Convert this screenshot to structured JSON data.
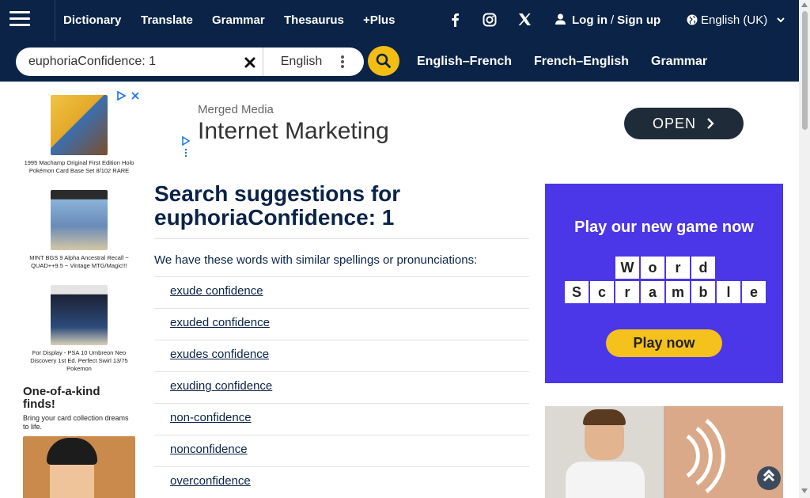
{
  "header": {
    "nav": [
      "Dictionary",
      "Translate",
      "Grammar",
      "Thesaurus",
      "+Plus"
    ],
    "social": [
      "facebook-icon",
      "instagram-icon",
      "x-icon"
    ],
    "login_label": "Log in",
    "signup_label": "Sign up",
    "language": "English (UK)"
  },
  "search": {
    "value": "euphoriaConfidence: 1",
    "language": "English"
  },
  "subnav": [
    "English–French",
    "French–English",
    "Grammar"
  ],
  "left_ad": {
    "cards": [
      "1995 Machamp Original First Edition Holo Pokémon Card Base Set 8/102 RARE",
      "MINT BGS 9 Alpha Ancestral Recall ~ QUAD++9.5 ~ Vintage MTG/Magic!!!",
      "For Display - PSA 10 Umbreon Neo Discovery 1st Ed. Perfect Swirl 13/75 Pokemon"
    ],
    "promo_big": "One-of-a-kind finds!",
    "promo_small": "Bring your card collection dreams to life."
  },
  "top_ad": {
    "brand": "Merged Media",
    "headline": "Internet Marketing",
    "button": "OPEN"
  },
  "main": {
    "title_prefix": "Search suggestions for",
    "title_term": "euphoriaConfidence: 1",
    "lead": "We have these words with similar spellings or pronunciations:",
    "suggestions": [
      "exude confidence",
      "exuded confidence",
      "exudes confidence",
      "exuding confidence",
      "non-confidence",
      "nonconfidence",
      "overconfidence"
    ]
  },
  "game_ad": {
    "title": "Play our new game now",
    "row1": [
      "W",
      "o",
      "r",
      "d"
    ],
    "row2": [
      "S",
      "c",
      "r",
      "a",
      "m",
      "b",
      "l",
      "e"
    ],
    "button": "Play now"
  },
  "colors": {
    "navy": "#0a2347",
    "yellow": "#f3bd14",
    "game_purple": "#4b36e8"
  }
}
